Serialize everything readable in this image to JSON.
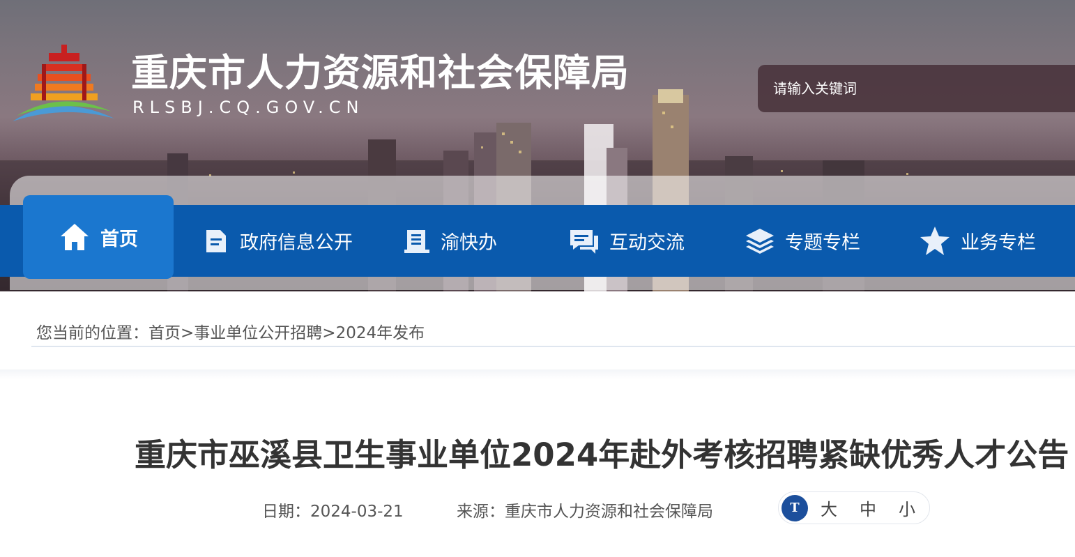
{
  "header": {
    "site_title": "重庆市人力资源和社会保障局",
    "site_domain": "RLSBJ.CQ.GOV.CN",
    "search_placeholder": "请输入关键词"
  },
  "nav": {
    "items": [
      {
        "label": "首页",
        "icon": "home-icon",
        "active": true
      },
      {
        "label": "政府信息公开",
        "icon": "document-icon"
      },
      {
        "label": "渝快办",
        "icon": "book-icon"
      },
      {
        "label": "互动交流",
        "icon": "chat-icon"
      },
      {
        "label": "专题专栏",
        "icon": "layers-icon"
      },
      {
        "label": "业务专栏",
        "icon": "star-icon"
      }
    ]
  },
  "breadcrumb": {
    "prefix": "您当前的位置：",
    "items": [
      "首页",
      "事业单位公开招聘",
      "2024年发布"
    ],
    "separator": ">"
  },
  "article": {
    "title": "重庆市巫溪县卫生事业单位2024年赴外考核招聘紧缺优秀人才公告",
    "date_label": "日期：2024-03-21",
    "source_label": "来源：重庆市人力资源和社会保障局"
  },
  "font_size": {
    "icon_text": "T",
    "options": [
      "大",
      "中",
      "小"
    ]
  },
  "colors": {
    "nav_bg": "#0a5aad",
    "nav_active_bg": "#1b77cf",
    "text_primary": "#333333",
    "text_secondary": "#555555",
    "icon_circle": "#1c4f9c"
  }
}
